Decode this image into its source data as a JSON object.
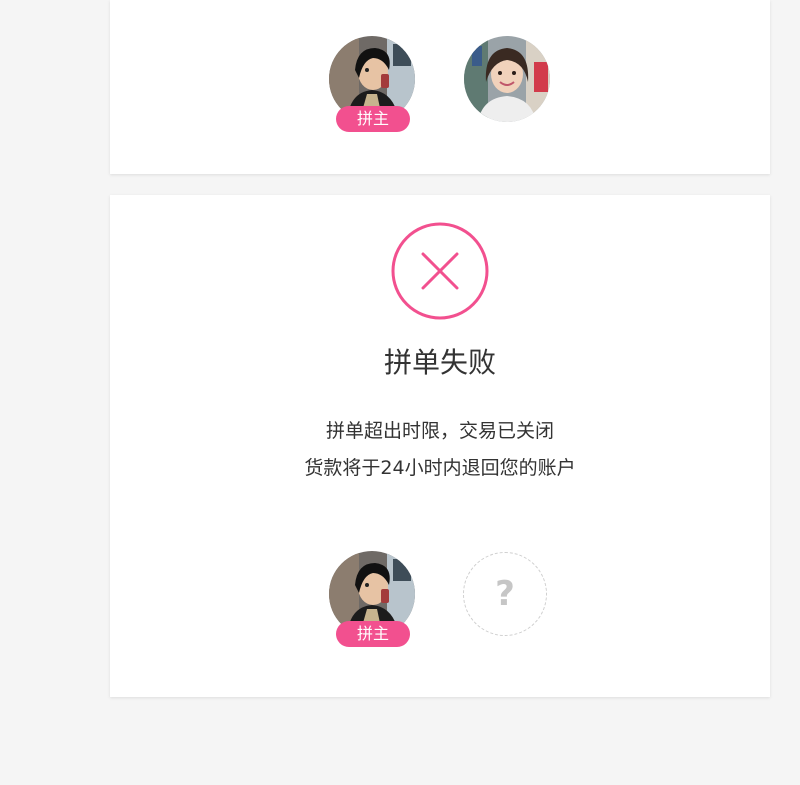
{
  "colors": {
    "accent": "#f2508f",
    "page_background": "#f5f5f5",
    "card_background": "#ffffff",
    "text": "#333333",
    "placeholder": "#cfcfcf"
  },
  "group_summary": {
    "leader_tag": "拼主",
    "members": [
      "leader-avatar",
      "member-avatar"
    ]
  },
  "result": {
    "icon": "close-circle-icon",
    "title": "拼单失败",
    "message_line_1": "拼单超出时限，交易已关闭",
    "message_line_2": "货款将于24小时内退回您的账户",
    "leader_tag": "拼主",
    "empty_slot_symbol": "?"
  }
}
